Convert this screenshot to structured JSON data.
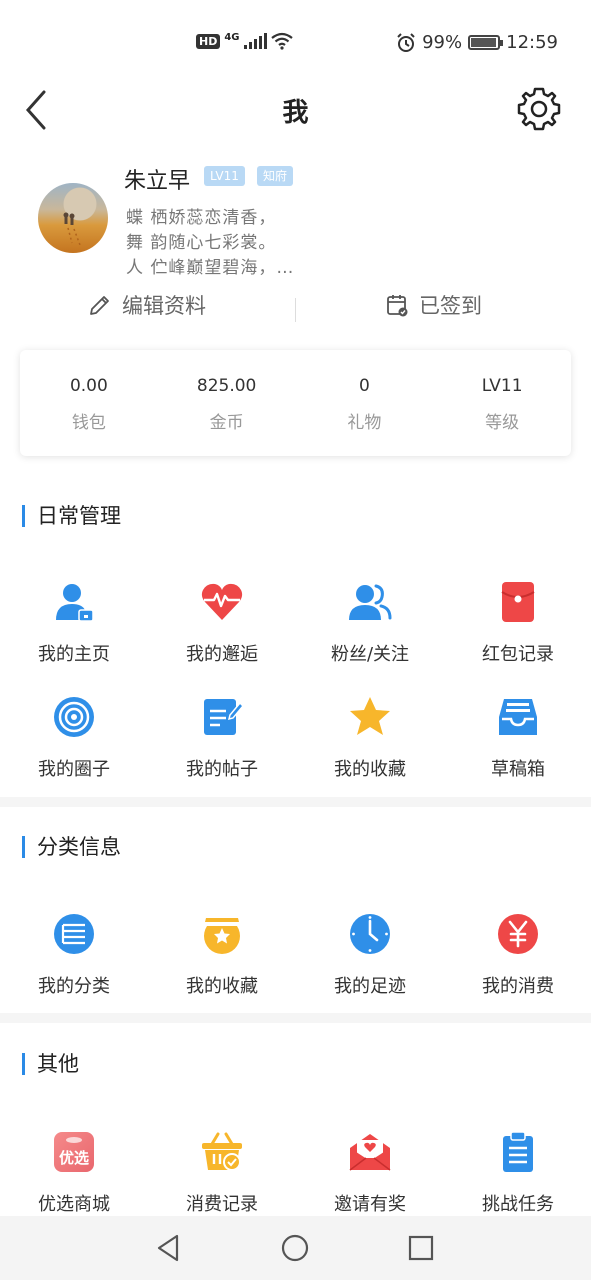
{
  "status_bar": {
    "network": "4G",
    "hd": "HD",
    "battery_pct": "99%",
    "time": "12:59"
  },
  "header": {
    "title": "我"
  },
  "profile": {
    "name": "朱立早",
    "badges": [
      "LV11",
      "知府"
    ],
    "bio": [
      "蝶 栖娇蕊恋清香，",
      "舞 韵随心七彩裳。",
      "人 伫峰巅望碧海，…"
    ],
    "edit_label": "编辑资料",
    "checkin_label": "已签到"
  },
  "stats": [
    {
      "value": "0.00",
      "label": "钱包"
    },
    {
      "value": "825.00",
      "label": "金币"
    },
    {
      "value": "0",
      "label": "礼物"
    },
    {
      "value": "LV11",
      "label": "等级"
    }
  ],
  "daily": {
    "title": "日常管理",
    "items": [
      {
        "label": "我的主页",
        "icon": "user-home-icon"
      },
      {
        "label": "我的邂逅",
        "icon": "heartbeat-icon"
      },
      {
        "label": "粉丝/关注",
        "icon": "followers-icon"
      },
      {
        "label": "红包记录",
        "icon": "red-envelope-icon"
      },
      {
        "label": "我的圈子",
        "icon": "circle-icon"
      },
      {
        "label": "我的帖子",
        "icon": "post-icon"
      },
      {
        "label": "我的收藏",
        "icon": "star-icon"
      },
      {
        "label": "草稿箱",
        "icon": "drafts-icon"
      }
    ]
  },
  "classified": {
    "title": "分类信息",
    "items": [
      {
        "label": "我的分类",
        "icon": "list-icon"
      },
      {
        "label": "我的收藏",
        "icon": "favorite-box-icon"
      },
      {
        "label": "我的足迹",
        "icon": "clock-icon"
      },
      {
        "label": "我的消费",
        "icon": "yuan-icon"
      }
    ]
  },
  "other": {
    "title": "其他",
    "items": [
      {
        "label": "优选商城",
        "icon": "mall-icon",
        "icon_text": "优选"
      },
      {
        "label": "消费记录",
        "icon": "basket-icon"
      },
      {
        "label": "邀请有奖",
        "icon": "invite-mail-icon"
      },
      {
        "label": "挑战任务",
        "icon": "clipboard-icon"
      }
    ]
  },
  "colors": {
    "accent": "#2a8ae6",
    "blue_icon": "#2f8fe8",
    "red_icon": "#ee4747",
    "yellow_icon": "#f7b62b"
  }
}
